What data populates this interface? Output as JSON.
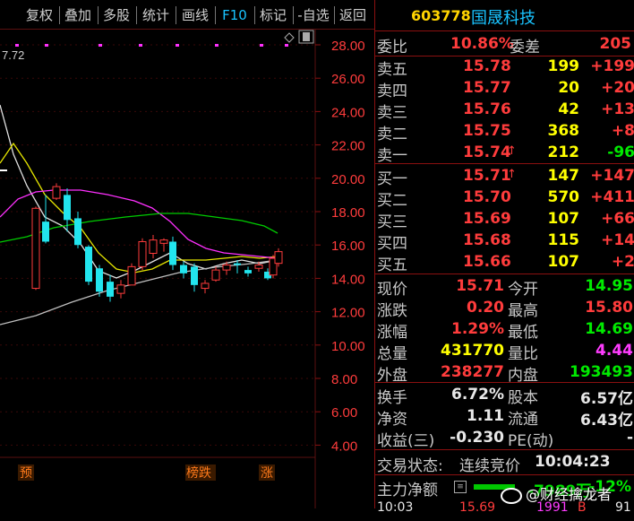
{
  "toolbar": {
    "items": [
      "复权",
      "叠加",
      "多股",
      "统计",
      "画线",
      "F10",
      "标记",
      "-自选",
      "返回"
    ]
  },
  "chart": {
    "top_left_value": "7.72",
    "price_axis": [
      "28.00",
      "26.00",
      "24.00",
      "22.00",
      "20.00",
      "18.00",
      "16.00",
      "14.00",
      "12.00",
      "10.00",
      "8.00",
      "6.00",
      "4.00"
    ],
    "markers": {
      "yu": "预",
      "bangdie": "榜跌",
      "zhang": "涨"
    },
    "colors": {
      "up": "#ff3c3c",
      "down": "#22e5ee",
      "ma5": "#e0e0e0",
      "ma10": "#e6e600",
      "ma20": "#ff30ff",
      "ma60": "#00cc00"
    }
  },
  "quote": {
    "code": "603778",
    "name": "国晟科技",
    "weibi": {
      "label": "委比",
      "value": "10.86%",
      "label2": "委差",
      "value2": "205"
    },
    "asks": [
      {
        "label": "卖五",
        "price": "15.78",
        "vol": "199",
        "chg": "+199"
      },
      {
        "label": "卖四",
        "price": "15.77",
        "vol": "20",
        "chg": "+20"
      },
      {
        "label": "卖三",
        "price": "15.76",
        "vol": "42",
        "chg": "+13"
      },
      {
        "label": "卖二",
        "price": "15.75",
        "vol": "368",
        "chg": "+8"
      },
      {
        "label": "卖一",
        "price": "15.74",
        "vol": "212",
        "chg": "-96",
        "arrow": "↑"
      }
    ],
    "bids": [
      {
        "label": "买一",
        "price": "15.71",
        "vol": "147",
        "chg": "+147",
        "arrow": "↑"
      },
      {
        "label": "买二",
        "price": "15.70",
        "vol": "570",
        "chg": "+411"
      },
      {
        "label": "买三",
        "price": "15.69",
        "vol": "107",
        "chg": "+66"
      },
      {
        "label": "买四",
        "price": "15.68",
        "vol": "115",
        "chg": "+14"
      },
      {
        "label": "买五",
        "price": "15.66",
        "vol": "107",
        "chg": "+2"
      }
    ],
    "stats": [
      {
        "l1": "现价",
        "v1": "15.71",
        "l2": "今开",
        "v2": "14.95"
      },
      {
        "l1": "涨跌",
        "v1": "0.20",
        "l2": "最高",
        "v2": "15.80"
      },
      {
        "l1": "涨幅",
        "v1": "1.29%",
        "l2": "最低",
        "v2": "14.69"
      },
      {
        "l1": "总量",
        "v1": "431770",
        "l2": "量比",
        "v2": "4.44"
      },
      {
        "l1": "外盘",
        "v1": "238277",
        "l2": "内盘",
        "v2": "193493"
      }
    ],
    "stats2": [
      {
        "l1": "换手",
        "v1": "6.72%",
        "l2": "股本",
        "v2": "6.57亿"
      },
      {
        "l1": "净资",
        "v1": "1.11",
        "l2": "流通",
        "v2": "6.43亿"
      },
      {
        "l1": "收益(三)",
        "v1": "-0.230",
        "l2": "PE(动)",
        "v2": "-"
      }
    ],
    "status": {
      "label": "交易状态:",
      "value": "连续竞价",
      "time": "10:04:23"
    },
    "main_flow": {
      "label": "主力净额",
      "value": "-7989万",
      "pct": "-12%"
    },
    "bottom_row": {
      "time": "10:03",
      "price": "15.69",
      "vol": "1991",
      "dir": "B",
      "num": "91"
    },
    "watermark": "@财经擒龙者"
  }
}
